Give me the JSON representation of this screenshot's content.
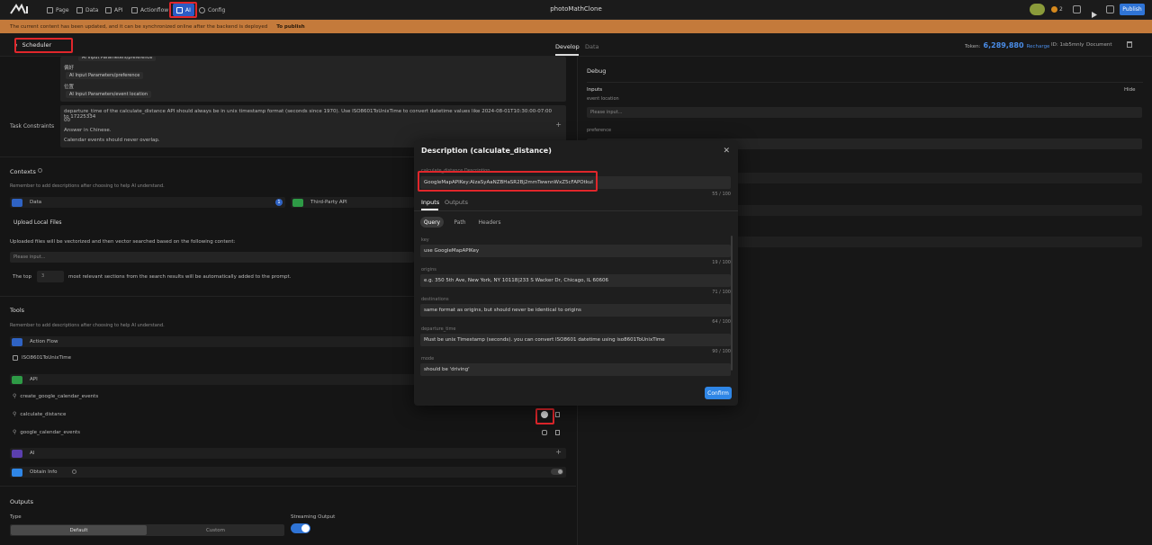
{
  "topbar": {
    "nav": [
      {
        "label": "Page",
        "icon": "page-icon"
      },
      {
        "label": "Data",
        "icon": "data-icon"
      },
      {
        "label": "API",
        "icon": "api-icon"
      },
      {
        "label": "Actionflow",
        "icon": "actionflow-icon"
      },
      {
        "label": "AI",
        "icon": "ai-icon"
      },
      {
        "label": "Config",
        "icon": "gear-icon"
      }
    ],
    "app_title": "photoMathClone",
    "coin_count": "2",
    "publish_label": "Publish"
  },
  "banner": {
    "message": "The current content has been updated, and it can be synchronized online after the backend is deployed",
    "link": "To publish"
  },
  "subbar": {
    "back_label": "Scheduler",
    "tab_develop": "Develop",
    "tab_data": "Data",
    "token_label": "Token:",
    "token_value": "6,289,880",
    "recharge": "Recharge",
    "id": "ID: 1sb5mnly",
    "document": "Document"
  },
  "left": {
    "prefs_label_1": "偏好",
    "prefs_tag_1": "AI Input Parameters/preference",
    "prefs_label_2": "位置",
    "prefs_tag_2": "AI Input Parameters/event location",
    "task_constraints_label": "Task Constraints",
    "task_line_1": "departure_time of the calculate_distance API should always be in unix timestamp format (seconds since 1970). Use ISO8601ToUnixTime to convert datetime values like 2024-08-01T10:30:00-07:00 to 17225334",
    "task_line_1b": "00",
    "task_line_2": "Answer in Chinese.",
    "task_line_3": "Calendar events should never overlap.",
    "contexts_title": "Contexts",
    "contexts_hint": "Remember to add descriptions after choosing to help AI understand.",
    "ctx_data": "Data",
    "ctx_data_count": "1",
    "ctx_third": "Third-Party API",
    "upload_title": "Upload Local Files",
    "upload_hint": "Uploaded files will be vectorized and then vector searched based on the following content:",
    "upload_placeholder": "Please input...",
    "top_prefix": "The top",
    "top_value": "3",
    "top_suffix": "most relevant sections from the search results will be automatically added to the prompt.",
    "tools_title": "Tools",
    "tools_hint": "Remember to add descriptions after choosing to help AI understand.",
    "tool_actionflow": "Action Flow",
    "tool_iso": "ISO8601ToUnixTime",
    "tool_api": "API",
    "tool_api_items": [
      "create_google_calendar_events",
      "calculate_distance",
      "google_calendar_events"
    ],
    "tool_ai": "AI",
    "tool_obtain": "Obtain Info",
    "outputs_title": "Outputs",
    "type_label": "Type",
    "type_default": "Default",
    "type_custom": "Custom",
    "streaming_label": "Streaming Output"
  },
  "right": {
    "debug_title": "Debug",
    "inputs_label": "Inputs",
    "hide_label": "Hide",
    "event_location_label": "event location",
    "event_location_placeholder": "Please input...",
    "preference_label": "preference"
  },
  "modal": {
    "title": "Description (calculate_distance)",
    "desc_label": "calculate_distance Description",
    "desc_value": "GoogleMapAPIKey:AIzaSyAaNZBHaSR2Bj2mmTwwnnWxZ5cFAPOtkuI",
    "desc_count": "55 / 100",
    "tab_inputs": "Inputs",
    "tab_outputs": "Outputs",
    "pill_query": "Query",
    "pill_path": "Path",
    "pill_headers": "Headers",
    "params": [
      {
        "label": "key",
        "value": "use GoogleMapAPIKey",
        "count": "19 / 100"
      },
      {
        "label": "origins",
        "value": "e.g. 350 5th Ave, New York, NY 10118|233 S Wacker Dr, Chicago, IL 60606",
        "count": "71 / 100"
      },
      {
        "label": "destinations",
        "value": "same format as origins, but should never be identical to origins",
        "count": "64 / 100"
      },
      {
        "label": "departure_time",
        "value": "Must be unix Timestamp (seconds). you can convert ISO8601 datetime using iso8601ToUnixTime",
        "count": "90 / 100"
      },
      {
        "label": "mode",
        "value": "should be 'driving'",
        "count": ""
      }
    ],
    "confirm_label": "Confirm"
  },
  "colors": {
    "accent": "#2f86e6",
    "highlight": "#e0262b",
    "banner": "#c47a3b"
  }
}
